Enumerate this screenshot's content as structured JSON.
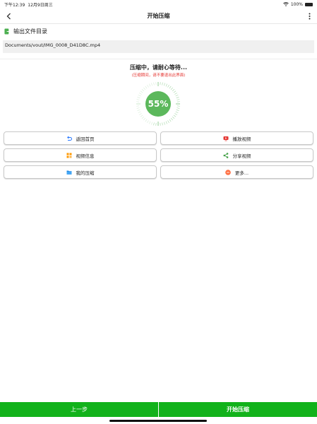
{
  "status": {
    "time": "下午12:39",
    "date": "12月9日周三",
    "battery": "100%"
  },
  "nav": {
    "title": "开始压缩"
  },
  "output": {
    "label": "输出文件目录",
    "path": "Documents/vout/IMG_0008_D41D8C.mp4"
  },
  "progress": {
    "title": "压缩中，请耐心等待...",
    "hint": "(压缩期间，请不要退出此界面)",
    "percent_text": "55%",
    "percent": 55
  },
  "actions": [
    {
      "label": "返回首页",
      "icon": "return-icon"
    },
    {
      "label": "播放视频",
      "icon": "play-video-icon"
    },
    {
      "label": "视频信息",
      "icon": "grid-info-icon"
    },
    {
      "label": "分享视频",
      "icon": "share-icon"
    },
    {
      "label": "我的压缩",
      "icon": "folder-icon"
    },
    {
      "label": "更多...",
      "icon": "more-dots-icon"
    }
  ],
  "footer": {
    "prev": "上一步",
    "start": "开始压缩"
  },
  "colors": {
    "accent": "#12b21b",
    "ring": "#5cb85c",
    "hint": "#e53935"
  }
}
